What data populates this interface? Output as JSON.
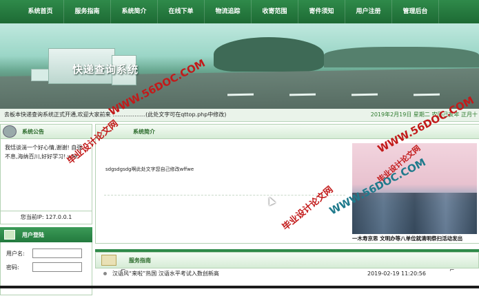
{
  "nav": {
    "items": [
      "系统首页",
      "服务指南",
      "系统简介",
      "在线下单",
      "物流追踪",
      "收寄范围",
      "寄件须知",
      "用户注册",
      "管理后台"
    ]
  },
  "banner": {
    "title": "快递查询系统"
  },
  "watermarks": {
    "site": "WWW.56DOC.COM",
    "name": "毕业设计论文网"
  },
  "ticker": {
    "text": "去板本快递查询系统正式开通,欢迎大家前来 ………………(此处文字可在qttop.php中修改)",
    "date": "2019年2月19日 星期二 农历己亥年 正月十"
  },
  "notice": {
    "title": "系统公告",
    "body": "我恬谈淌一个好心情,谢谢! 自强不息,海纳百川,好好学习! wfe"
  },
  "ip": {
    "text": "您当前IP: 127.0.0.1"
  },
  "login": {
    "title": "用户登陆",
    "username_label": "用户名:",
    "password_label": "密码:"
  },
  "intro": {
    "title": "系统简介",
    "text": "sdgsdgsdg啊此处文字您自己修改wffwe"
  },
  "picture": {
    "caption": "一木寿京思 文明办等八单位就清明祭扫活动发出"
  },
  "service": {
    "title": "服务指南",
    "items": [
      {
        "title": "汉语风“来啦”热国 汉语水平考试入数创新高",
        "date": "2019-02-19 11:20:56"
      }
    ]
  },
  "colors": {
    "nav": "#2f8a4a",
    "accent": "#2b6b2b",
    "watermark_red": "#c21a1a",
    "watermark_teal": "#1f7a8c"
  }
}
